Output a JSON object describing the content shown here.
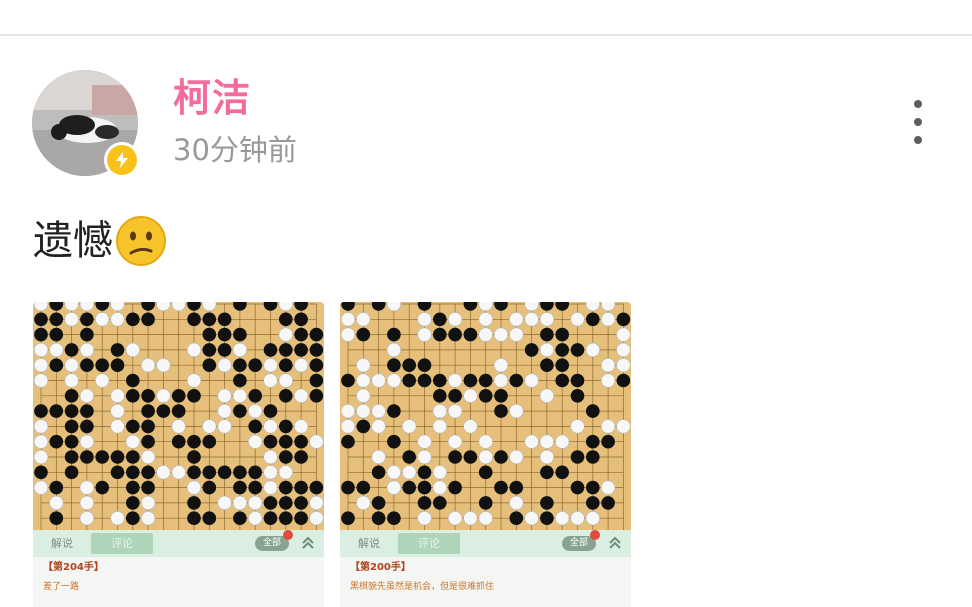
{
  "post": {
    "username": "柯洁",
    "time": "30分钟前",
    "text": "遗憾"
  },
  "icons": {
    "avatar": "user-photo-cat",
    "badge": "lightning-icon",
    "more": "more-vertical-icon",
    "emoji": "confused-face-emoji"
  },
  "colors": {
    "username": "#f26d9d",
    "badge": "#f8c21a",
    "board": "#e8c27c"
  },
  "images": [
    {
      "tab_explain": "解说",
      "tab_comment": "评论",
      "all_button": "全部",
      "move_label": "【第204手】",
      "comment_text": "差了一路"
    },
    {
      "tab_explain": "解说",
      "tab_comment": "评论",
      "all_button": "全部",
      "move_label": "【第200手】",
      "comment_text": "黑棋貌先虽然是机会，但是很难抓住"
    }
  ]
}
